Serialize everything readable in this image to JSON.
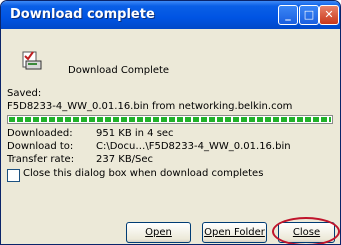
{
  "window": {
    "title": "Download complete"
  },
  "headline": "Download Complete",
  "saved": {
    "label": "Saved:",
    "value": "F5D8233-4_WW_0.01.16.bin from networking.belkin.com"
  },
  "progress": {
    "fraction": 1.0
  },
  "details": [
    {
      "label": "Downloaded:",
      "value": "951 KB in 4 sec"
    },
    {
      "label": "Download to:",
      "value": "C:\\Docu…\\F5D8233-4_WW_0.01.16.bin"
    },
    {
      "label": "Transfer rate:",
      "value": "237 KB/Sec"
    }
  ],
  "close_when_done": {
    "label": "Close this dialog box when download completes",
    "checked": false
  },
  "buttons": {
    "open": "Open",
    "open_folder": "Open Folder",
    "close": "Close"
  },
  "colors": {
    "titlebar": "#0054e3",
    "progress": "#21b12a",
    "annotation": "#c0142b"
  }
}
